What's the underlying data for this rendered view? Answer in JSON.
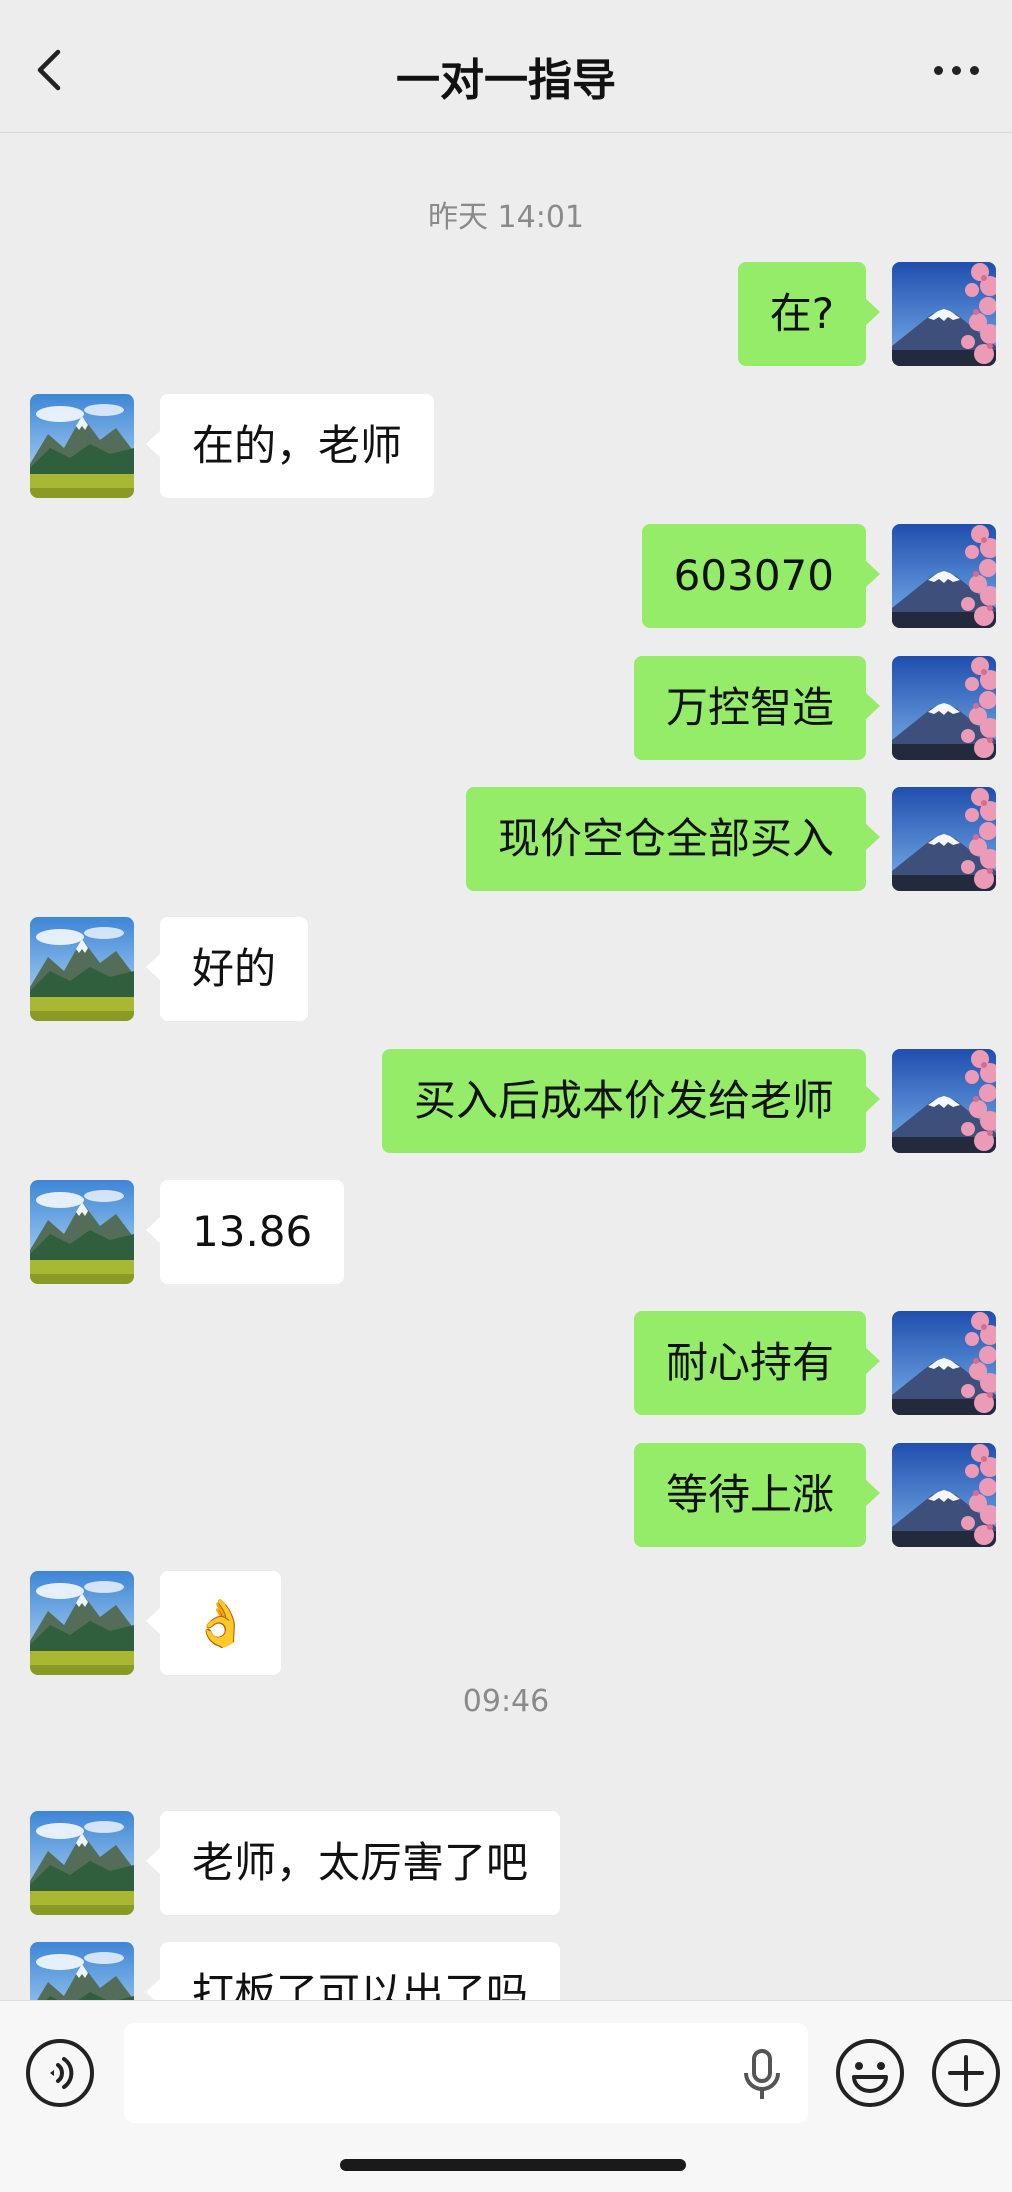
{
  "header": {
    "title": "一对一指导"
  },
  "messages": [
    {
      "type": "timestamp",
      "text": "昨天 14:01"
    },
    {
      "type": "msg",
      "from": "me",
      "text": "在?"
    },
    {
      "type": "msg",
      "from": "them",
      "text": "在的，老师"
    },
    {
      "type": "msg",
      "from": "me",
      "text": "603070"
    },
    {
      "type": "msg",
      "from": "me",
      "text": "万控智造"
    },
    {
      "type": "msg",
      "from": "me",
      "text": "现价空仓全部买入"
    },
    {
      "type": "msg",
      "from": "them",
      "text": "好的"
    },
    {
      "type": "msg",
      "from": "me",
      "text": "买入后成本价发给老师"
    },
    {
      "type": "msg",
      "from": "them",
      "text": "13.86"
    },
    {
      "type": "msg",
      "from": "me",
      "text": "耐心持有"
    },
    {
      "type": "msg",
      "from": "me",
      "text": "等待上涨"
    },
    {
      "type": "msg",
      "from": "them",
      "text": "👌",
      "emoji": "ok-hand-emoji"
    },
    {
      "type": "timestamp",
      "text": "09:46"
    },
    {
      "type": "msg",
      "from": "them",
      "text": "老师，太厉害了吧"
    },
    {
      "type": "msg",
      "from": "them",
      "text": "打板了可以出了吗"
    }
  ],
  "input": {
    "value": "",
    "placeholder": ""
  },
  "icons": {
    "back": "back-icon",
    "more": "more-icon",
    "voice": "voice-icon",
    "mic": "mic-icon",
    "emoji": "emoji-icon",
    "plus": "plus-icon"
  },
  "colors": {
    "background": "#ededed",
    "my_bubble": "#95ec69",
    "their_bubble": "#ffffff",
    "timestamp": "#8a8a8a"
  }
}
